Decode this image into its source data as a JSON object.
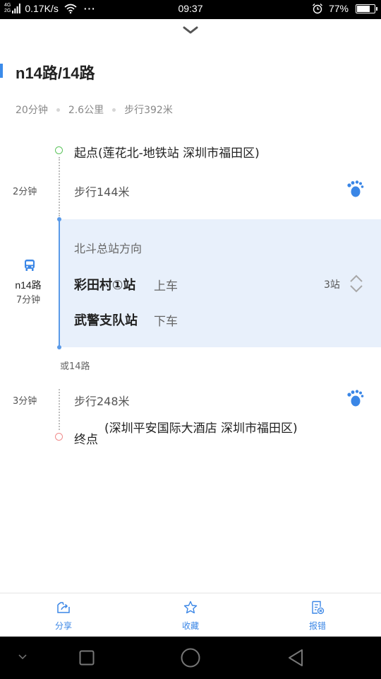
{
  "status_bar": {
    "network_top": "4G",
    "network_bottom": "2G",
    "speed": "0.17K/s",
    "more": "···",
    "time": "09:37",
    "battery_percent": "77%",
    "battery_level": 0.77
  },
  "route": {
    "title": "n14路/14路",
    "summary": {
      "duration": "20分钟",
      "distance": "2.6公里",
      "walk": "步行392米"
    }
  },
  "steps": {
    "start": "起点(莲花北-地铁站 深圳市福田区)",
    "walk1": {
      "duration": "2分钟",
      "text": "步行144米"
    },
    "bus": {
      "route": "n14路",
      "duration": "7分钟",
      "direction": "北斗总站方向",
      "board_stop": "彩田村①站",
      "board_action": "上车",
      "stop_count": "3站",
      "alight_stop": "武警支队站",
      "alight_action": "下车"
    },
    "alternative": "或14路",
    "walk2": {
      "duration": "3分钟",
      "text": "步行248米"
    },
    "end_label": "终点",
    "end_detail": "(深圳平安国际大酒店 深圳市福田区)"
  },
  "actions": {
    "share": "分享",
    "favorite": "收藏",
    "report": "报错"
  },
  "colors": {
    "accent": "#3a86e6",
    "panel": "#e8f0fb",
    "start_dot": "#5cc45c",
    "end_dot": "#f08b8b"
  },
  "icons": {
    "walk": "footprint-icon",
    "bus": "bus-icon",
    "share": "share-icon",
    "favorite": "star-icon",
    "report": "report-icon"
  }
}
